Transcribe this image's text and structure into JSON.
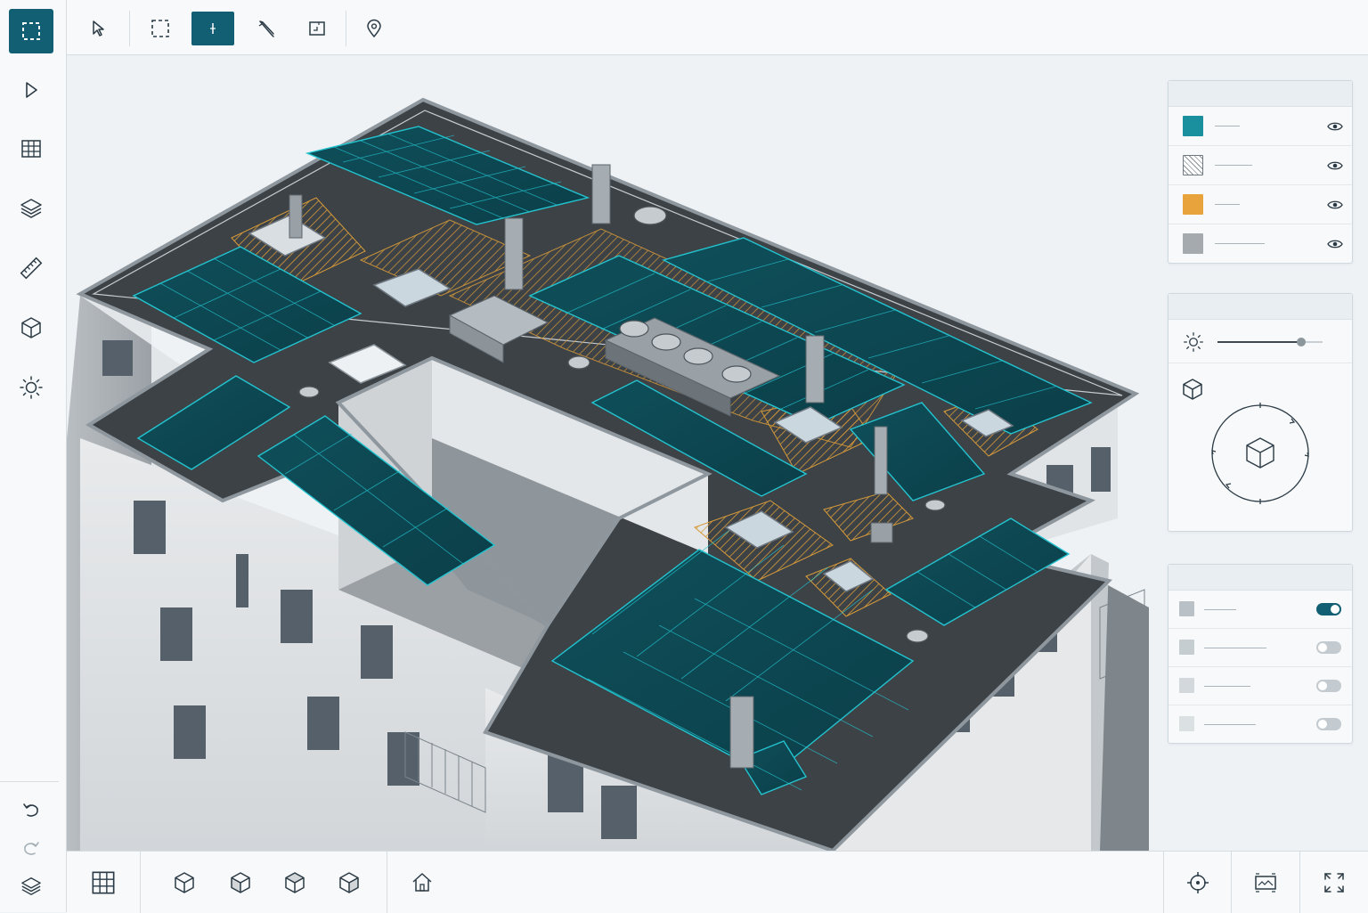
{
  "colors": {
    "accent": "#125f73",
    "teal_layer": "#1a8f9e",
    "hatched_layer": "#b8c2c8",
    "orange_layer": "#e8a33d",
    "gray_layer": "#a4aaae",
    "toggle_on": "#125f73",
    "toggle_off": "#c4cbd0"
  },
  "left_rail": [
    {
      "icon": "marquee-select-icon",
      "active": true
    },
    {
      "icon": "pointer-icon",
      "active": false
    },
    {
      "icon": "grid-icon",
      "active": false
    },
    {
      "icon": "layers-icon",
      "active": false
    },
    {
      "icon": "ruler-icon",
      "active": false
    },
    {
      "icon": "cube-icon",
      "active": false
    },
    {
      "icon": "sun-icon",
      "active": false
    },
    {
      "icon": "undo-icon",
      "active": false
    },
    {
      "icon": "redo-icon",
      "active": false
    },
    {
      "icon": "layers-icon",
      "active": false
    }
  ],
  "top_toolbar": [
    {
      "icon": "pointer-icon",
      "active": false
    },
    {
      "icon": "marquee-select-icon",
      "active": false
    },
    {
      "icon": "crosshair-icon",
      "active": true
    },
    {
      "icon": "pen-icon",
      "active": false
    },
    {
      "icon": "frame-icon",
      "active": false
    },
    {
      "icon": "map-pin-icon",
      "active": false
    }
  ],
  "layers_panel": {
    "rows": [
      {
        "swatch": "teal",
        "visible": true
      },
      {
        "swatch": "hatched",
        "visible": true
      },
      {
        "swatch": "orange",
        "visible": true
      },
      {
        "swatch": "gray",
        "visible": true
      }
    ]
  },
  "view_panel": {
    "sun_slider": 0.8,
    "icons": [
      "sun-icon",
      "cube-icon",
      "orbit-icon"
    ]
  },
  "toggles_panel": {
    "rows": [
      {
        "on": true
      },
      {
        "on": false
      },
      {
        "on": false
      },
      {
        "on": false
      }
    ]
  },
  "bottom_toolbar": [
    {
      "icon": "grid-icon"
    },
    {
      "icon": "view-cube-front-icon"
    },
    {
      "icon": "view-cube-left-icon"
    },
    {
      "icon": "view-cube-top-icon"
    },
    {
      "icon": "view-cube-right-icon"
    },
    {
      "icon": "home-icon"
    },
    {
      "icon": "target-icon"
    },
    {
      "icon": "screenshot-icon"
    },
    {
      "icon": "fullscreen-icon"
    }
  ]
}
